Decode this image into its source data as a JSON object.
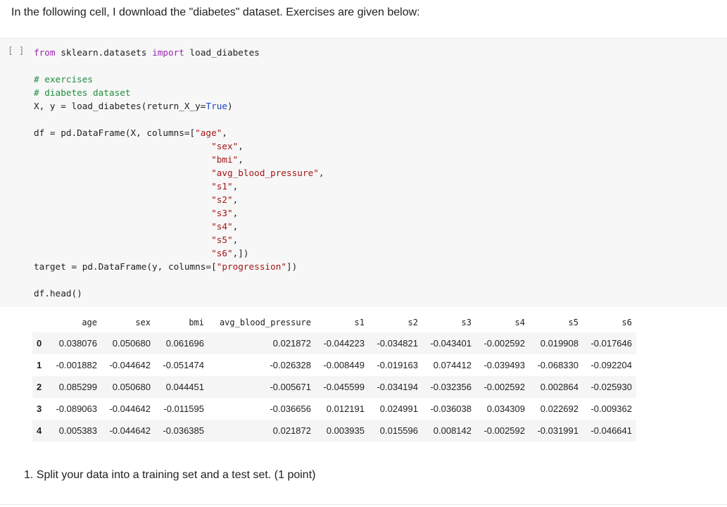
{
  "intro_text": "In the following cell, I download the \"diabetes\" dataset. Exercises are given below:",
  "cell": {
    "run_bracket": "[ ]",
    "lines": [
      [
        {
          "t": "from",
          "c": "kw"
        },
        {
          "t": " sklearn.datasets ",
          "c": ""
        },
        {
          "t": "import",
          "c": "kw"
        },
        {
          "t": " load_diabetes",
          "c": ""
        }
      ],
      [],
      [
        {
          "t": "# exercises",
          "c": "cm"
        }
      ],
      [
        {
          "t": "# diabetes dataset",
          "c": "cm"
        }
      ],
      [
        {
          "t": "X, y = load_diabetes(return_X_y=",
          "c": ""
        },
        {
          "t": "True",
          "c": "bool"
        },
        {
          "t": ")",
          "c": ""
        }
      ],
      [],
      [
        {
          "t": "df = pd.DataFrame(X, columns=[",
          "c": ""
        },
        {
          "t": "\"age\"",
          "c": "str"
        },
        {
          "t": ",",
          "c": ""
        }
      ],
      [
        {
          "t": "                                 ",
          "c": ""
        },
        {
          "t": "\"sex\"",
          "c": "str"
        },
        {
          "t": ",",
          "c": ""
        }
      ],
      [
        {
          "t": "                                 ",
          "c": ""
        },
        {
          "t": "\"bmi\"",
          "c": "str"
        },
        {
          "t": ",",
          "c": ""
        }
      ],
      [
        {
          "t": "                                 ",
          "c": ""
        },
        {
          "t": "\"avg_blood_pressure\"",
          "c": "str"
        },
        {
          "t": ",",
          "c": ""
        }
      ],
      [
        {
          "t": "                                 ",
          "c": ""
        },
        {
          "t": "\"s1\"",
          "c": "str"
        },
        {
          "t": ",",
          "c": ""
        }
      ],
      [
        {
          "t": "                                 ",
          "c": ""
        },
        {
          "t": "\"s2\"",
          "c": "str"
        },
        {
          "t": ",",
          "c": ""
        }
      ],
      [
        {
          "t": "                                 ",
          "c": ""
        },
        {
          "t": "\"s3\"",
          "c": "str"
        },
        {
          "t": ",",
          "c": ""
        }
      ],
      [
        {
          "t": "                                 ",
          "c": ""
        },
        {
          "t": "\"s4\"",
          "c": "str"
        },
        {
          "t": ",",
          "c": ""
        }
      ],
      [
        {
          "t": "                                 ",
          "c": ""
        },
        {
          "t": "\"s5\"",
          "c": "str"
        },
        {
          "t": ",",
          "c": ""
        }
      ],
      [
        {
          "t": "                                 ",
          "c": ""
        },
        {
          "t": "\"s6\"",
          "c": "str"
        },
        {
          "t": ",])",
          "c": ""
        }
      ],
      [
        {
          "t": "target = pd.DataFrame(y, columns=[",
          "c": ""
        },
        {
          "t": "\"progression\"",
          "c": "str"
        },
        {
          "t": "])",
          "c": ""
        }
      ],
      [],
      [
        {
          "t": "df.head()",
          "c": ""
        }
      ]
    ]
  },
  "output_table": {
    "columns": [
      "age",
      "sex",
      "bmi",
      "avg_blood_pressure",
      "s1",
      "s2",
      "s3",
      "s4",
      "s5",
      "s6"
    ],
    "rows": [
      {
        "index": "0",
        "values": [
          "0.038076",
          "0.050680",
          "0.061696",
          "0.021872",
          "-0.044223",
          "-0.034821",
          "-0.043401",
          "-0.002592",
          "0.019908",
          "-0.017646"
        ]
      },
      {
        "index": "1",
        "values": [
          "-0.001882",
          "-0.044642",
          "-0.051474",
          "-0.026328",
          "-0.008449",
          "-0.019163",
          "0.074412",
          "-0.039493",
          "-0.068330",
          "-0.092204"
        ]
      },
      {
        "index": "2",
        "values": [
          "0.085299",
          "0.050680",
          "0.044451",
          "-0.005671",
          "-0.045599",
          "-0.034194",
          "-0.032356",
          "-0.002592",
          "0.002864",
          "-0.025930"
        ]
      },
      {
        "index": "3",
        "values": [
          "-0.089063",
          "-0.044642",
          "-0.011595",
          "-0.036656",
          "0.012191",
          "0.024991",
          "-0.036038",
          "0.034309",
          "0.022692",
          "-0.009362"
        ]
      },
      {
        "index": "4",
        "values": [
          "0.005383",
          "-0.044642",
          "-0.036385",
          "0.021872",
          "0.003935",
          "0.015596",
          "0.008142",
          "-0.002592",
          "-0.031991",
          "-0.046641"
        ]
      }
    ]
  },
  "exercise_1": "1. Split your data into a training set and a test set. (1 point)",
  "colors": {
    "keyword": "#9c27b0",
    "comment": "#1e8e3e",
    "string": "#a31515",
    "boolean": "#1a46c8",
    "cell_background": "#f7f7f7",
    "row_stripe": "#f5f5f5"
  }
}
